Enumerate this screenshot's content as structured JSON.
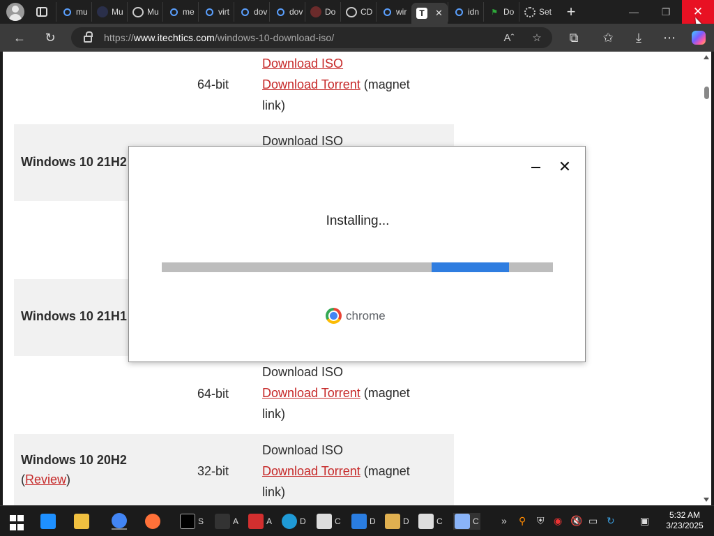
{
  "browser": {
    "tabs": [
      {
        "label": "mu",
        "icon": "search-icon"
      },
      {
        "label": "Mu",
        "icon": "site-icon"
      },
      {
        "label": "Mu",
        "icon": "globe-icon"
      },
      {
        "label": "me",
        "icon": "search-icon"
      },
      {
        "label": "virt",
        "icon": "search-icon"
      },
      {
        "label": "dov",
        "icon": "search-icon"
      },
      {
        "label": "dov",
        "icon": "search-icon"
      },
      {
        "label": "Do",
        "icon": "site-icon"
      },
      {
        "label": "CD",
        "icon": "globe-icon"
      },
      {
        "label": "wir",
        "icon": "search-icon"
      },
      {
        "label": "T",
        "icon": "site-icon",
        "active": true
      },
      {
        "label": "idn",
        "icon": "search-icon"
      },
      {
        "label": "Do",
        "icon": "flag-icon"
      },
      {
        "label": "Set",
        "icon": "gear-icon"
      }
    ],
    "url_prefix": "https://",
    "url_host": "www.itechtics.com",
    "url_path": "/windows-10-download-iso/"
  },
  "page": {
    "download_iso": "Download ISO",
    "download_torrent": "Download Torrent",
    "magnet_suffix": " (magnet",
    "magnet_line2": "link)",
    "rows": [
      {
        "version": "",
        "arch": "64-bit"
      },
      {
        "version": "Windows 10 21H2",
        "arch": ""
      },
      {
        "version": "Windows 10 21H1",
        "arch": ""
      },
      {
        "version": "",
        "arch": "64-bit"
      },
      {
        "version": "Windows 10 20H2",
        "arch": "32-bit",
        "review": "Review"
      }
    ]
  },
  "dialog": {
    "status": "Installing...",
    "brand": "chrome",
    "progress": {
      "fill_start": 0.69,
      "fill_end": 0.888
    }
  },
  "taskbar": {
    "apps": [
      {
        "name": "S"
      },
      {
        "name": "A"
      },
      {
        "name": "A"
      },
      {
        "name": "D"
      },
      {
        "name": "C"
      },
      {
        "name": "D"
      },
      {
        "name": "D"
      },
      {
        "name": "C"
      },
      {
        "name": "C"
      }
    ],
    "time": "5:32 AM",
    "date": "3/23/2025"
  },
  "colors": {
    "link": "#c62828",
    "progress": "#2f7de0",
    "close_hover": "#e81123"
  }
}
